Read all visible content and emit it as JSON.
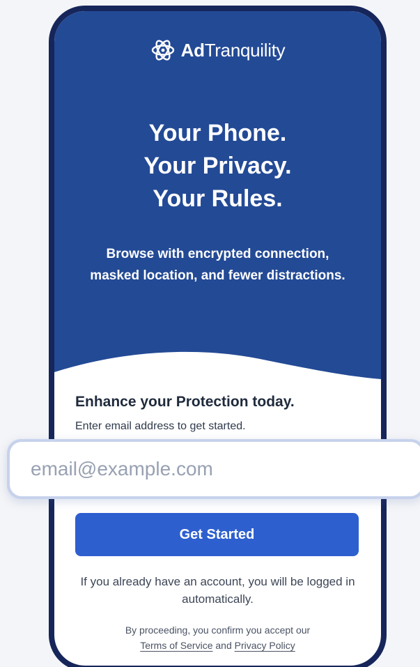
{
  "brand": {
    "logo_icon": "atom-shield-icon",
    "name_bold": "Ad",
    "name_regular": "Tranquility"
  },
  "hero": {
    "headline": [
      "Your Phone.",
      "Your Privacy.",
      "Your Rules."
    ],
    "subtext": "Browse with encrypted connection, masked location, and fewer distractions."
  },
  "signup": {
    "title": "Enhance your Protection today.",
    "subtitle": "Enter email address to get started.",
    "email_placeholder": "email@example.com",
    "email_value": "",
    "cta_label": "Get Started",
    "login_note": "If you already have an account, you will be logged in automatically."
  },
  "legal": {
    "prefix": "By proceeding, you confirm you accept our",
    "terms_label": "Terms of Service",
    "and": "and",
    "privacy_label": "Privacy Policy"
  },
  "colors": {
    "hero_bg": "#234a95",
    "frame": "#16265a",
    "cta_bg": "#2e5fcf",
    "input_ring": "#c7d2ec"
  }
}
